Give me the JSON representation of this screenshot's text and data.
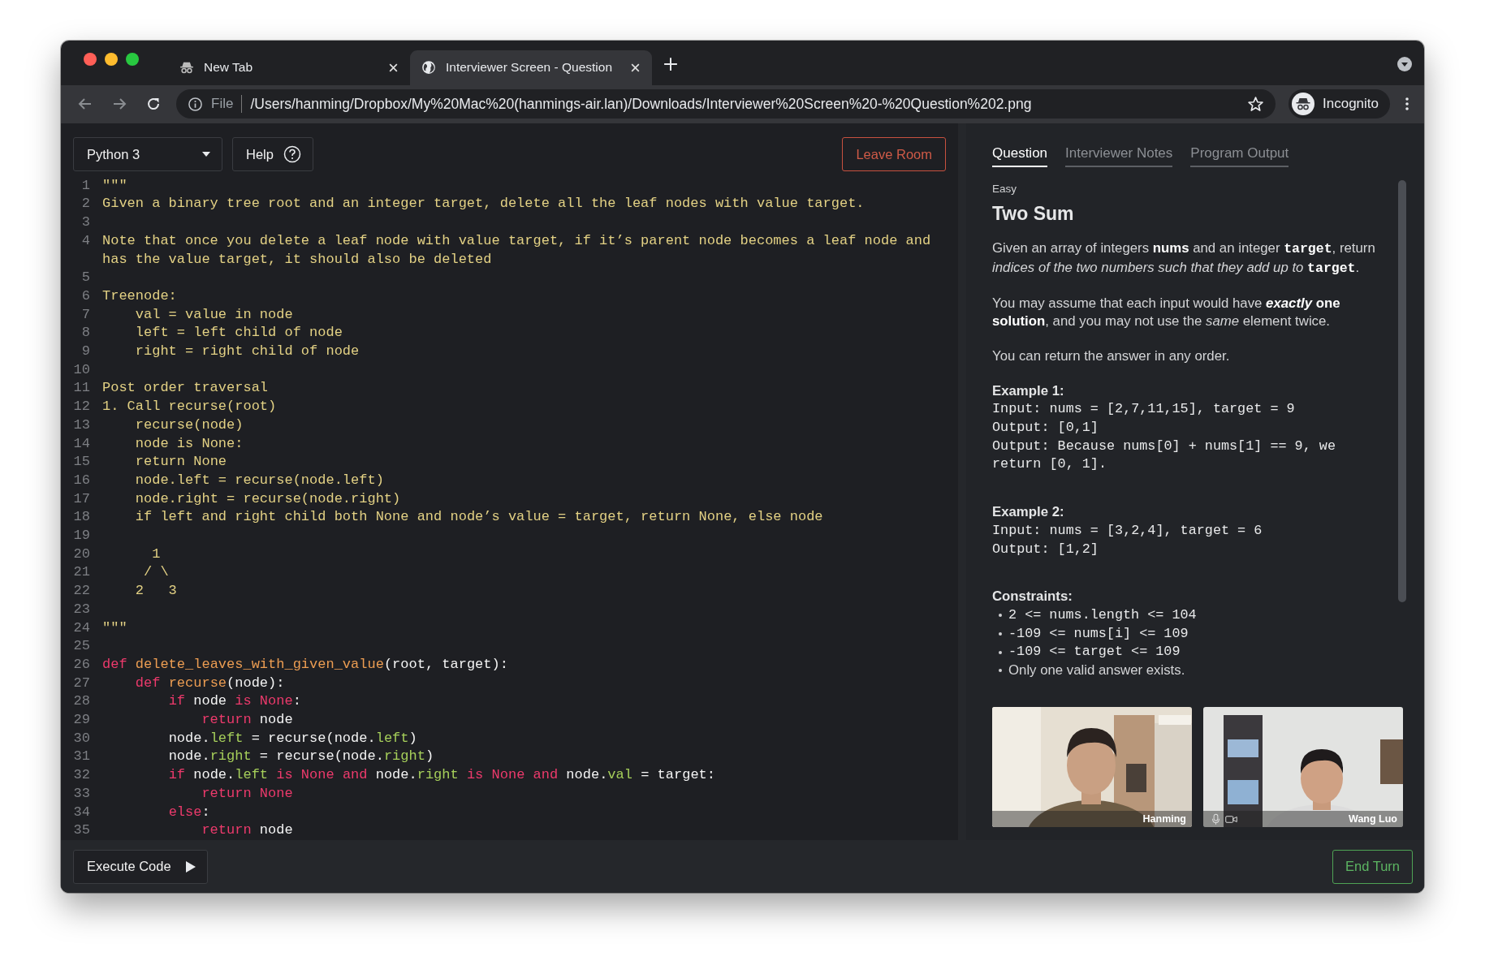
{
  "browser": {
    "tabs": [
      {
        "title": "New Tab",
        "kind": "incognito",
        "selected": false
      },
      {
        "title": "Interviewer Screen - Question",
        "kind": "page",
        "selected": true
      }
    ],
    "address": {
      "scheme": "File",
      "url": "/Users/hanming/Dropbox/My%20Mac%20(hanmings-air.lan)/Downloads/Interviewer%20Screen%20-%20Question%202.png"
    },
    "profile": "Incognito"
  },
  "editor": {
    "language": "Python 3",
    "help": "Help",
    "leave": "Leave Room",
    "lines": [
      {
        "number": "1",
        "tokens": [
          {
            "text": "\"\"\"",
            "kind": "doc"
          }
        ]
      },
      {
        "number": "2",
        "tokens": [
          {
            "text": "Given a binary tree root and an integer target, delete all the leaf nodes with value target.",
            "kind": "doc"
          }
        ]
      },
      {
        "number": "3"
      },
      {
        "number": "4",
        "tokens": [
          {
            "text": "Note that once you delete a leaf node with value target, if it’s parent node becomes a leaf node and has the value target, it should also be deleted",
            "kind": "doc"
          }
        ]
      },
      {
        "number": "5"
      },
      {
        "number": "6",
        "tokens": [
          {
            "text": "Treenode:",
            "kind": "doc"
          }
        ]
      },
      {
        "number": "7",
        "tokens": [
          {
            "text": "    val = value in node",
            "kind": "doc"
          }
        ]
      },
      {
        "number": "8",
        "tokens": [
          {
            "text": "    left = left child of node",
            "kind": "doc"
          }
        ]
      },
      {
        "number": "9",
        "tokens": [
          {
            "text": "    right = right child of node",
            "kind": "doc"
          }
        ]
      },
      {
        "number": "10"
      },
      {
        "number": "11",
        "tokens": [
          {
            "text": "Post order traversal",
            "kind": "doc"
          }
        ]
      },
      {
        "number": "12",
        "tokens": [
          {
            "text": "1. Call recurse(root)",
            "kind": "doc"
          }
        ]
      },
      {
        "number": "13",
        "tokens": [
          {
            "text": "    recurse(node)",
            "kind": "doc"
          }
        ]
      },
      {
        "number": "14",
        "tokens": [
          {
            "text": "    node is None:",
            "kind": "doc"
          }
        ]
      },
      {
        "number": "15",
        "tokens": [
          {
            "text": "    return None",
            "kind": "doc"
          }
        ]
      },
      {
        "number": "16",
        "tokens": [
          {
            "text": "    node.left = recurse(node.left)",
            "kind": "doc"
          }
        ]
      },
      {
        "number": "17",
        "tokens": [
          {
            "text": "    node.right = recurse(node.right)",
            "kind": "doc"
          }
        ]
      },
      {
        "number": "18",
        "tokens": [
          {
            "text": "    if left and right child both None and node’s value = target, return None, else node",
            "kind": "doc"
          }
        ]
      },
      {
        "number": "19"
      },
      {
        "number": "20",
        "tokens": [
          {
            "text": "      1",
            "kind": "doc"
          }
        ]
      },
      {
        "number": "21",
        "tokens": [
          {
            "text": "     / \\",
            "kind": "doc"
          }
        ]
      },
      {
        "number": "22",
        "tokens": [
          {
            "text": "    2   3",
            "kind": "doc"
          }
        ]
      },
      {
        "number": "23"
      },
      {
        "number": "24",
        "tokens": [
          {
            "text": "\"\"\"",
            "kind": "doc"
          }
        ]
      },
      {
        "number": "25"
      },
      {
        "number": "26",
        "tokens": [
          {
            "text": "def ",
            "kind": "keyword"
          },
          {
            "text": "delete_leaves_with_given_value",
            "kind": "function"
          },
          {
            "text": "(root, target):",
            "kind": "plain"
          }
        ]
      },
      {
        "number": "27",
        "tokens": [
          {
            "text": "    def ",
            "kind": "keyword"
          },
          {
            "text": "recurse",
            "kind": "function"
          },
          {
            "text": "(node):",
            "kind": "plain"
          }
        ]
      },
      {
        "number": "28",
        "tokens": [
          {
            "text": "        if",
            "kind": "keyword"
          },
          {
            "text": " node ",
            "kind": "plain"
          },
          {
            "text": "is None",
            "kind": "keyword"
          },
          {
            "text": ":",
            "kind": "plain"
          }
        ]
      },
      {
        "number": "29",
        "tokens": [
          {
            "text": "            return",
            "kind": "keyword"
          },
          {
            "text": " node",
            "kind": "plain"
          }
        ]
      },
      {
        "number": "30",
        "tokens": [
          {
            "text": "        node.",
            "kind": "plain"
          },
          {
            "text": "left",
            "kind": "attribute"
          },
          {
            "text": " = recurse(node.",
            "kind": "plain"
          },
          {
            "text": "left",
            "kind": "attribute"
          },
          {
            "text": ")",
            "kind": "plain"
          }
        ]
      },
      {
        "number": "31",
        "tokens": [
          {
            "text": "        node.",
            "kind": "plain"
          },
          {
            "text": "right",
            "kind": "attribute"
          },
          {
            "text": " = recurse(node.",
            "kind": "plain"
          },
          {
            "text": "right",
            "kind": "attribute"
          },
          {
            "text": ")",
            "kind": "plain"
          }
        ]
      },
      {
        "number": "32",
        "tokens": [
          {
            "text": "        if",
            "kind": "keyword"
          },
          {
            "text": " node.",
            "kind": "plain"
          },
          {
            "text": "left",
            "kind": "attribute"
          },
          {
            "text": " is None and",
            "kind": "keyword"
          },
          {
            "text": " node.",
            "kind": "plain"
          },
          {
            "text": "right",
            "kind": "attribute"
          },
          {
            "text": " is None and",
            "kind": "keyword"
          },
          {
            "text": " node.",
            "kind": "plain"
          },
          {
            "text": "val",
            "kind": "attribute"
          },
          {
            "text": " = target:",
            "kind": "plain"
          }
        ]
      },
      {
        "number": "33",
        "tokens": [
          {
            "text": "            return None",
            "kind": "keyword"
          }
        ]
      },
      {
        "number": "34",
        "tokens": [
          {
            "text": "        else",
            "kind": "keyword"
          },
          {
            "text": ":",
            "kind": "plain"
          }
        ]
      },
      {
        "number": "35",
        "tokens": [
          {
            "text": "            return",
            "kind": "keyword"
          },
          {
            "text": " node",
            "kind": "plain"
          }
        ]
      }
    ],
    "execute": "Execute Code"
  },
  "panel": {
    "tabs": [
      {
        "label": "Question",
        "selected": true
      },
      {
        "label": "Interviewer Notes",
        "selected": false
      },
      {
        "label": "Program Output",
        "selected": false
      }
    ],
    "difficulty": "Easy",
    "title": "Two Sum",
    "paragraphs": [
      [
        {
          "text": "Given an array of integers ",
          "kind": "plain"
        },
        {
          "text": "nums",
          "kind": "bold"
        },
        {
          "text": " and an integer ",
          "kind": "plain"
        },
        {
          "text": "target",
          "kind": "code"
        },
        {
          "text": ", return ",
          "kind": "plain"
        },
        {
          "text": "indices of the two numbers such that they add up to ",
          "kind": "italic"
        },
        {
          "text": "target",
          "kind": "code"
        },
        {
          "text": ".",
          "kind": "plain"
        }
      ],
      [
        {
          "text": "You may assume that each input would have ",
          "kind": "plain"
        },
        {
          "text": "exactly",
          "kind": "bold-italic"
        },
        {
          "text": " one solution",
          "kind": "bold"
        },
        {
          "text": ", and you may not use the ",
          "kind": "plain"
        },
        {
          "text": "same",
          "kind": "italic"
        },
        {
          "text": " element twice.",
          "kind": "plain"
        }
      ],
      [
        {
          "text": "You can return the answer in any order.",
          "kind": "plain"
        }
      ]
    ],
    "examples": [
      {
        "heading": "Example 1:",
        "lines": [
          "Input: nums = [2,7,11,15], target = 9",
          "Output: [0,1]",
          "Output: Because nums[0] + nums[1] == 9, we return [0, 1]."
        ]
      },
      {
        "heading": "Example 2:",
        "lines": [
          "Input: nums = [3,2,4], target = 6",
          "Output: [1,2]"
        ]
      }
    ],
    "constraints": {
      "heading": "Constraints:",
      "items": [
        {
          "text": "2 <= nums.length <= 104",
          "kind": "code"
        },
        {
          "text": "-109 <= nums[i] <= 109",
          "kind": "code"
        },
        {
          "text": "-109 <= target <= 109",
          "kind": "code"
        },
        {
          "text": "Only one valid answer exists.",
          "kind": "plain"
        }
      ]
    },
    "videos": [
      {
        "name": "Hanming",
        "kind": "picture",
        "media_icons": false
      },
      {
        "name": "Wang Luo",
        "kind": "picture",
        "media_icons": true
      }
    ],
    "end_turn": "End Turn"
  }
}
